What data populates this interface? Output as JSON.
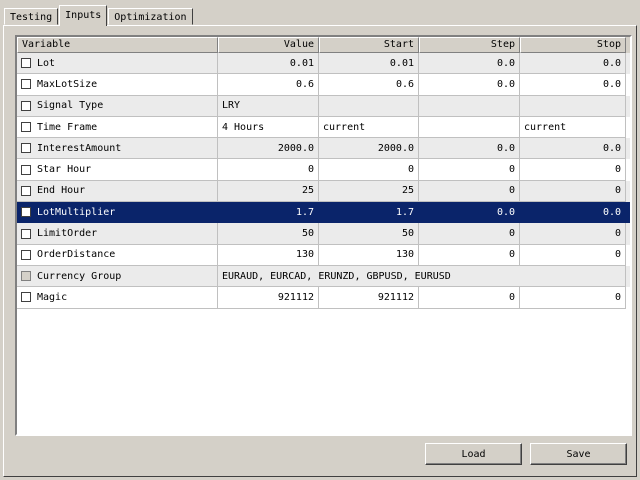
{
  "tabs": [
    {
      "label": "Testing"
    },
    {
      "label": "Inputs"
    },
    {
      "label": "Optimization"
    }
  ],
  "active_tab": "Inputs",
  "columns": {
    "variable": "Variable",
    "value": "Value",
    "start": "Start",
    "step": "Step",
    "stop": "Stop"
  },
  "rows": [
    {
      "name": "Lot",
      "value": "0.01",
      "start": "0.01",
      "step": "0.0",
      "stop": "0.0"
    },
    {
      "name": "MaxLotSize",
      "value": "0.6",
      "start": "0.6",
      "step": "0.0",
      "stop": "0.0"
    },
    {
      "name": "Signal Type",
      "value": "LRY",
      "start": "",
      "step": "",
      "stop": ""
    },
    {
      "name": "Time Frame",
      "value": "4 Hours",
      "start": "current",
      "step": "",
      "stop": "current"
    },
    {
      "name": "InterestAmount",
      "value": "2000.0",
      "start": "2000.0",
      "step": "0.0",
      "stop": "0.0"
    },
    {
      "name": "Star Hour",
      "value": "0",
      "start": "0",
      "step": "0",
      "stop": "0"
    },
    {
      "name": "End Hour",
      "value": "25",
      "start": "25",
      "step": "0",
      "stop": "0"
    },
    {
      "name": "LotMultiplier",
      "value": "1.7",
      "start": "1.7",
      "step": "0.0",
      "stop": "0.0"
    },
    {
      "name": "LimitOrder",
      "value": "50",
      "start": "50",
      "step": "0",
      "stop": "0"
    },
    {
      "name": "OrderDistance",
      "value": "130",
      "start": "130",
      "step": "0",
      "stop": "0"
    },
    {
      "name": "Currency Group",
      "value": "EURAUD, EURCAD, ERUNZD, GBPUSD, EURUSD"
    },
    {
      "name": "Magic",
      "value": "921112",
      "start": "921112",
      "step": "0",
      "stop": "0"
    }
  ],
  "buttons": {
    "load": "Load",
    "save": "Save"
  },
  "colors": {
    "window_bg": "#d4d0c8",
    "selection": "#0a246a",
    "alt_row": "#ebebeb"
  }
}
